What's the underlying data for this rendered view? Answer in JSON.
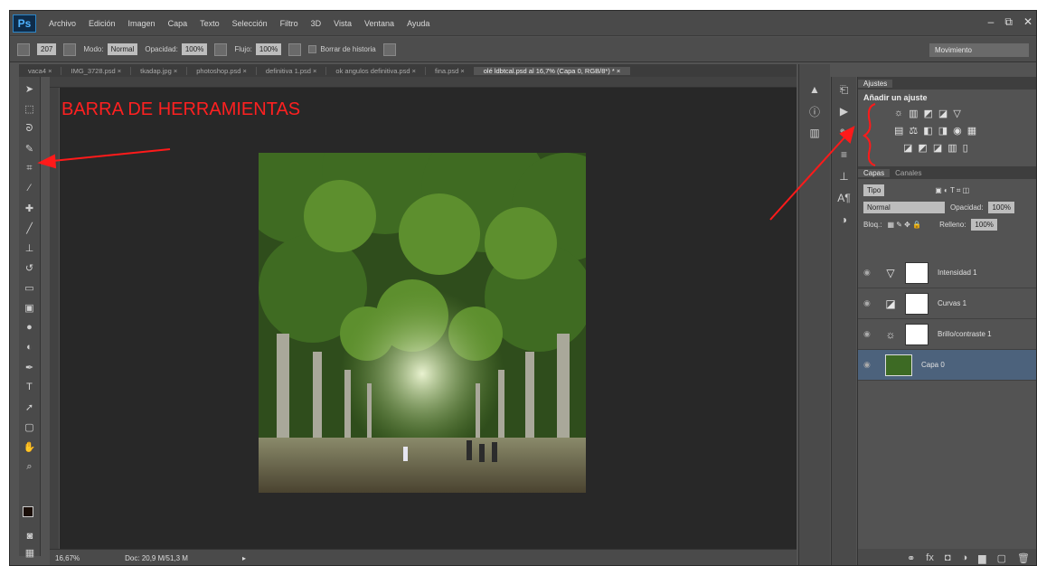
{
  "menu": {
    "logo": "Ps",
    "items": [
      "Archivo",
      "Edición",
      "Imagen",
      "Capa",
      "Texto",
      "Selección",
      "Filtro",
      "3D",
      "Vista",
      "Ventana",
      "Ayuda"
    ],
    "window_buttons": [
      "–",
      "⧉",
      "✕"
    ]
  },
  "options": {
    "mode_label": "Modo:",
    "mode_value": "Normal",
    "opacity_label": "Opacidad:",
    "opacity_value": "100%",
    "flow_label": "Flujo:",
    "flow_value": "100%",
    "history_label": "Borrar de historia",
    "brush_size": "207",
    "workspace": "Movimiento"
  },
  "tabs": [
    {
      "label": "vaca4 ×",
      "active": false
    },
    {
      "label": "IMG_3728.psd ×",
      "active": false
    },
    {
      "label": "tkadap.jpg ×",
      "active": false
    },
    {
      "label": "photoshop.psd ×",
      "active": false
    },
    {
      "label": "definitiva 1.psd ×",
      "active": false
    },
    {
      "label": "ok angulos definitiva.psd ×",
      "active": false
    },
    {
      "label": "fina.psd ×",
      "active": false
    },
    {
      "label": "olé ldbtcal.psd al 16,7% (Capa 0, RGB/8*) * ×",
      "active": true
    }
  ],
  "status": {
    "zoom": "16,67%",
    "doc": "Doc: 20,9 M/51,3 M"
  },
  "adjustments": {
    "tabs": [
      "Ajustes"
    ],
    "title": "Añadir un ajuste",
    "row1": [
      "☼",
      "▥",
      "◩",
      "◪",
      "▽"
    ],
    "row2": [
      "▤",
      "⚖",
      "◧",
      "◨",
      "◉",
      "▦"
    ],
    "row3": [
      "◪",
      "◩",
      "◪",
      "▥",
      "▯"
    ]
  },
  "layers_panel": {
    "tabs": [
      "Capas",
      "Canales"
    ],
    "kind_label": "Tipo",
    "blend_mode": "Normal",
    "opacity_label": "Opacidad:",
    "opacity_value": "100%",
    "lock_label": "Bloq.:",
    "fill_label": "Relleno:",
    "fill_value": "100%",
    "layers": [
      {
        "name": "Intensidad 1",
        "icon": "▽",
        "selected": false
      },
      {
        "name": "Curvas 1",
        "icon": "◪",
        "selected": false
      },
      {
        "name": "Brillo/contraste 1",
        "icon": "☼",
        "selected": false
      },
      {
        "name": "Capa 0",
        "icon": "",
        "selected": true
      }
    ]
  },
  "annotation": {
    "text": "BARRA DE HERRAMIENTAS",
    "color": "#ff2020"
  }
}
